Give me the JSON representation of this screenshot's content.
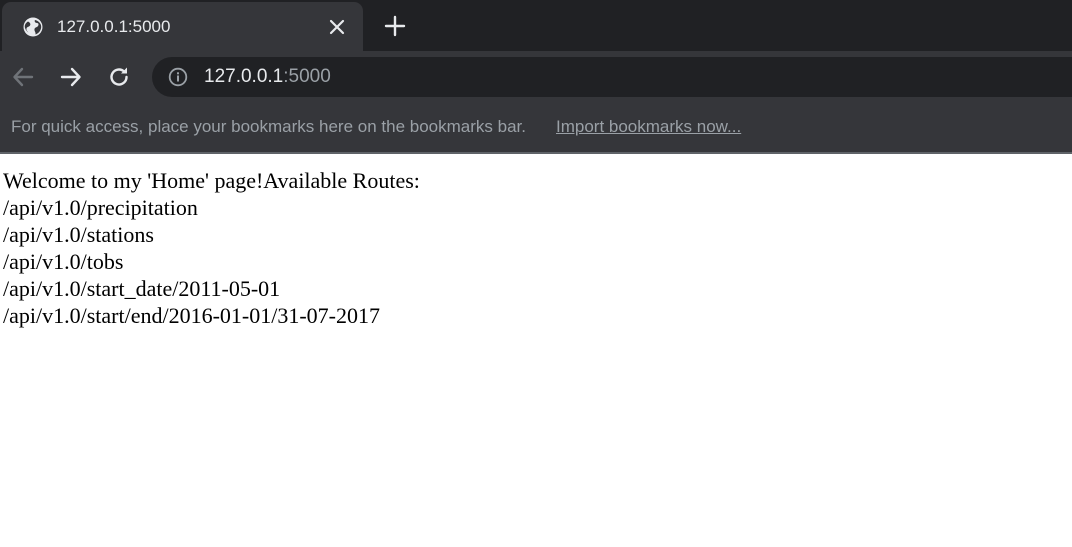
{
  "browser": {
    "tab": {
      "title": "127.0.0.1:5000",
      "favicon": "globe-icon",
      "close_icon": "close-icon"
    },
    "new_tab_icon": "plus-icon",
    "nav": {
      "back_icon": "arrow-left-icon",
      "forward_icon": "arrow-right-icon",
      "reload_icon": "reload-icon"
    },
    "omnibox": {
      "info_icon": "info-icon",
      "host": "127.0.0.1",
      "port": ":5000"
    },
    "bookmarks_bar": {
      "hint": "For quick access, place your bookmarks here on the bookmarks bar.",
      "import_link": "Import bookmarks now..."
    },
    "colors": {
      "frame": "#202124",
      "toolbar": "#35363a",
      "text": "#e8eaed",
      "muted": "#9aa0a6"
    }
  },
  "page": {
    "welcome": "Welcome to my 'Home' page!Available Routes:",
    "routes": [
      "/api/v1.0/precipitation",
      "/api/v1.0/stations",
      "/api/v1.0/tobs",
      "/api/v1.0/start_date/2011-05-01",
      "/api/v1.0/start/end/2016-01-01/31-07-2017"
    ]
  }
}
